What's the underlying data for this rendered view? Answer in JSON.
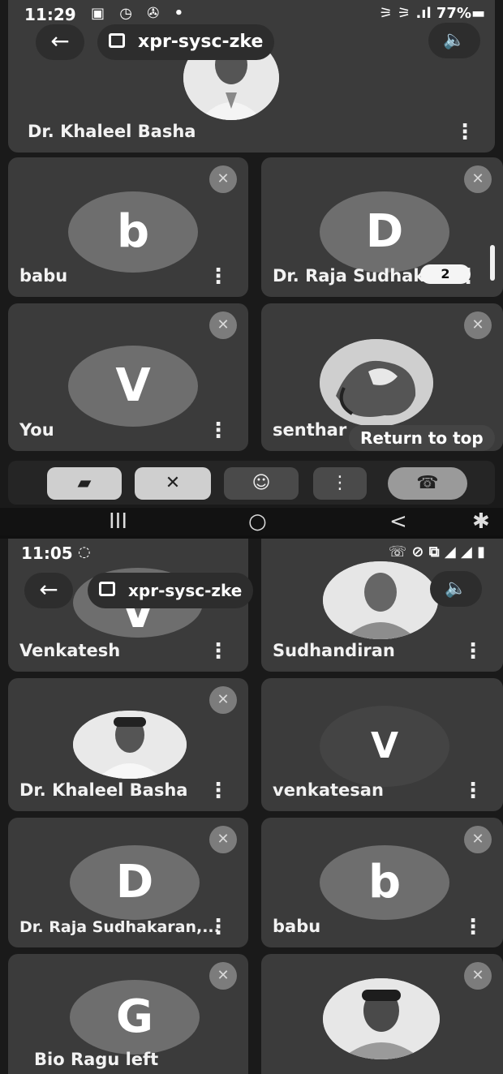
{
  "top": {
    "status": {
      "time": "11:29",
      "left_icons": "▣ ◷ ✇ •",
      "right": "⚞ ⚞ .ıl 77%▬"
    },
    "meeting_code": "xpr-sysc-zke",
    "featured_name": "Dr. Khaleel Basha",
    "tiles": [
      {
        "name": "babu",
        "letter": "b"
      },
      {
        "name": "Dr. Raja Sudhak...",
        "letter": "D"
      },
      {
        "name": "You",
        "letter": "V"
      },
      {
        "name": "senthar",
        "letter": ""
      }
    ],
    "badge_count": "2",
    "return_to_top": "Return to top",
    "nav": {
      "recents": "III",
      "home": "○",
      "back": "<",
      "accessibility": "✱"
    }
  },
  "bottom": {
    "status": {
      "time": "11:05",
      "left_icons": "◌",
      "right": "☏ ⊘ ⧉ ◢ ◢ ▮"
    },
    "meeting_code": "xpr-sysc-zke",
    "tiles": [
      {
        "name": "Venkatesh",
        "letter": "V"
      },
      {
        "name": "Sudhandiran",
        "letter": ""
      },
      {
        "name": "Dr. Khaleel Basha",
        "letter": ""
      },
      {
        "name": "venkatesan",
        "letter": "V"
      },
      {
        "name": "Dr. Raja Sudhakaran,...",
        "letter": "D"
      },
      {
        "name": "babu",
        "letter": "b"
      },
      {
        "name": "Bio Ragu left",
        "letter": "G"
      },
      {
        "name": "",
        "letter": ""
      }
    ]
  },
  "icons": {
    "back": "←",
    "speaker": "🔈",
    "kebab": "⋮",
    "mic_off": "✕",
    "camera_off": "▰",
    "mic_off_ctrl": "✕",
    "emoji": "☺",
    "more": "⋮",
    "hang_up": "☎"
  }
}
